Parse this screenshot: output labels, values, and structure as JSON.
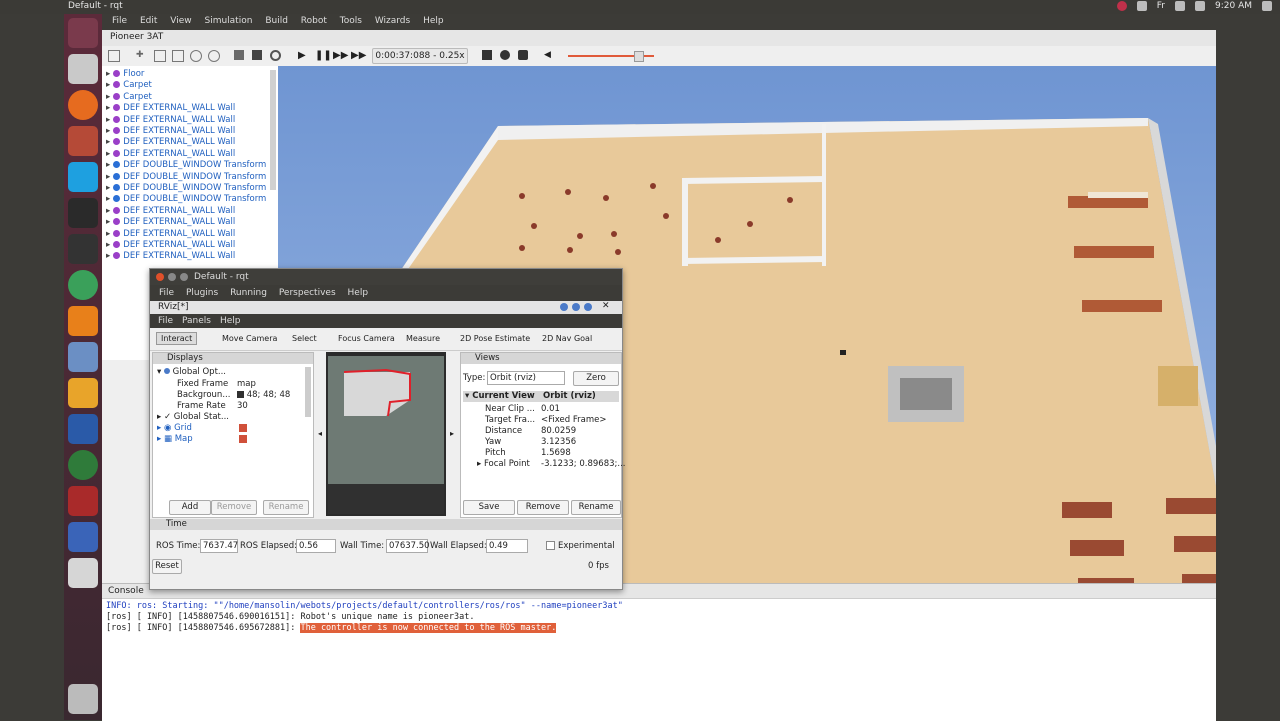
{
  "topbar": {
    "title": "Default - rqt",
    "time": "9:20 AM",
    "keyboard": "Fr"
  },
  "menubar": {
    "items": [
      "File",
      "Edit",
      "View",
      "Simulation",
      "Build",
      "Robot",
      "Tools",
      "Wizards",
      "Help"
    ]
  },
  "webots": {
    "title": "Pioneer 3AT",
    "sim_time": "0:00:37:088",
    "speed": "0.25x",
    "tree": [
      {
        "label": "Floor",
        "color": "#9a3fc8"
      },
      {
        "label": "Carpet",
        "color": "#9a3fc8"
      },
      {
        "label": "Carpet",
        "color": "#9a3fc8"
      },
      {
        "label": "DEF EXTERNAL_WALL Wall",
        "color": "#9a3fc8"
      },
      {
        "label": "DEF EXTERNAL_WALL Wall",
        "color": "#9a3fc8"
      },
      {
        "label": "DEF EXTERNAL_WALL Wall",
        "color": "#9a3fc8"
      },
      {
        "label": "DEF EXTERNAL_WALL Wall",
        "color": "#9a3fc8"
      },
      {
        "label": "DEF EXTERNAL_WALL Wall",
        "color": "#9a3fc8"
      },
      {
        "label": "DEF DOUBLE_WINDOW Transform",
        "color": "#2a6fd6"
      },
      {
        "label": "DEF DOUBLE_WINDOW Transform",
        "color": "#2a6fd6"
      },
      {
        "label": "DEF DOUBLE_WINDOW Transform",
        "color": "#2a6fd6"
      },
      {
        "label": "DEF DOUBLE_WINDOW Transform",
        "color": "#2a6fd6"
      },
      {
        "label": "DEF EXTERNAL_WALL Wall",
        "color": "#9a3fc8"
      },
      {
        "label": "DEF EXTERNAL_WALL Wall",
        "color": "#9a3fc8"
      },
      {
        "label": "DEF EXTERNAL_WALL Wall",
        "color": "#9a3fc8"
      },
      {
        "label": "DEF EXTERNAL_WALL Wall",
        "color": "#9a3fc8"
      },
      {
        "label": "DEF EXTERNAL_WALL Wall",
        "color": "#9a3fc8"
      }
    ],
    "console": {
      "title": "Console",
      "lines": [
        {
          "text": "INFO: ros: Starting: \"\"/home/mansolin/webots/projects/default/controllers/ros/ros\" --name=pioneer3at\"",
          "color": "#1f3fbf",
          "highlight": ""
        },
        {
          "text": "[ros] [ INFO] [1458807546.690016151]: Robot's unique name is pioneer3at.",
          "color": "#333",
          "highlight": ""
        },
        {
          "text": "[ros] [ INFO] [1458807546.695672881]: ",
          "color": "#333",
          "highlight": "The controller is now connected to the ROS master."
        }
      ]
    }
  },
  "rqt": {
    "title": "Default - rqt",
    "menu": [
      "File",
      "Plugins",
      "Running",
      "Perspectives",
      "Help"
    ],
    "rviz_title": "RViz[*]",
    "rviz_menu": [
      "File",
      "Panels",
      "Help"
    ],
    "tools": [
      "Interact",
      "Move Camera",
      "Select",
      "Focus Camera",
      "Measure",
      "2D Pose Estimate",
      "2D Nav Goal"
    ],
    "displays": {
      "title": "Displays",
      "rows": [
        {
          "name": "Global Opt...",
          "value": ""
        },
        {
          "name": "Fixed Frame",
          "value": "map"
        },
        {
          "name": "Backgroun...",
          "value": "48; 48; 48"
        },
        {
          "name": "Frame Rate",
          "value": "30"
        },
        {
          "name": "Global Stat...",
          "value": ""
        },
        {
          "name": "Grid",
          "value": ""
        },
        {
          "name": "Map",
          "value": ""
        }
      ],
      "buttons": [
        "Add",
        "Remove",
        "Rename"
      ]
    },
    "views": {
      "title": "Views",
      "type_label": "Type:",
      "type_value": "Orbit (rviz)",
      "zero": "Zero",
      "current_view": "Current View",
      "current_view_value": "Orbit (rviz)",
      "rows": [
        {
          "name": "Near Clip ...",
          "value": "0.01"
        },
        {
          "name": "Target Fra...",
          "value": "<Fixed Frame>"
        },
        {
          "name": "Distance",
          "value": "80.0259"
        },
        {
          "name": "Yaw",
          "value": "3.12356"
        },
        {
          "name": "Pitch",
          "value": "1.5698"
        },
        {
          "name": "Focal Point",
          "value": "-3.1233; 0.89683;..."
        }
      ],
      "buttons": [
        "Save",
        "Remove",
        "Rename"
      ]
    },
    "time": {
      "title": "Time",
      "ros_time_label": "ROS Time:",
      "ros_time": "7637.47",
      "ros_elapsed_label": "ROS Elapsed:",
      "ros_elapsed": "0.56",
      "wall_time_label": "Wall Time:",
      "wall_time": "07637.50",
      "wall_elapsed_label": "Wall Elapsed:",
      "wall_elapsed": "0.49",
      "experimental": "Experimental",
      "reset": "Reset",
      "fps": "0 fps"
    }
  }
}
